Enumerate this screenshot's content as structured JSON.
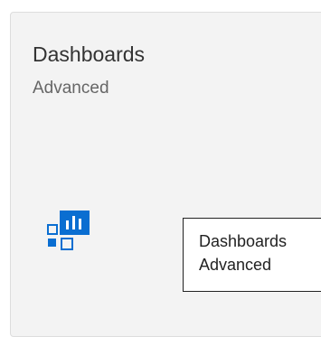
{
  "tile": {
    "title": "Dashboards",
    "subtitle": "Advanced",
    "icon": "dashboard-chart-icon",
    "accent_color": "#0a6ed1"
  },
  "tooltip": {
    "line1": "Dashboards",
    "line2": "Advanced"
  }
}
